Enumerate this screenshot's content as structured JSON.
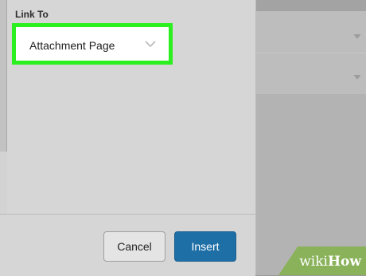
{
  "dialog": {
    "link_to_label": "Link To",
    "link_to_value": "Attachment Page",
    "cancel_label": "Cancel",
    "insert_label": "Insert"
  },
  "watermark": {
    "prefix": "wiki",
    "suffix": "How"
  },
  "colors": {
    "highlight": "#2bef1e",
    "primary_button": "#1f6fa7"
  },
  "icons": {
    "select_chevron": "chevron-down-icon",
    "right_chevrons": "chevron-down-icon"
  }
}
